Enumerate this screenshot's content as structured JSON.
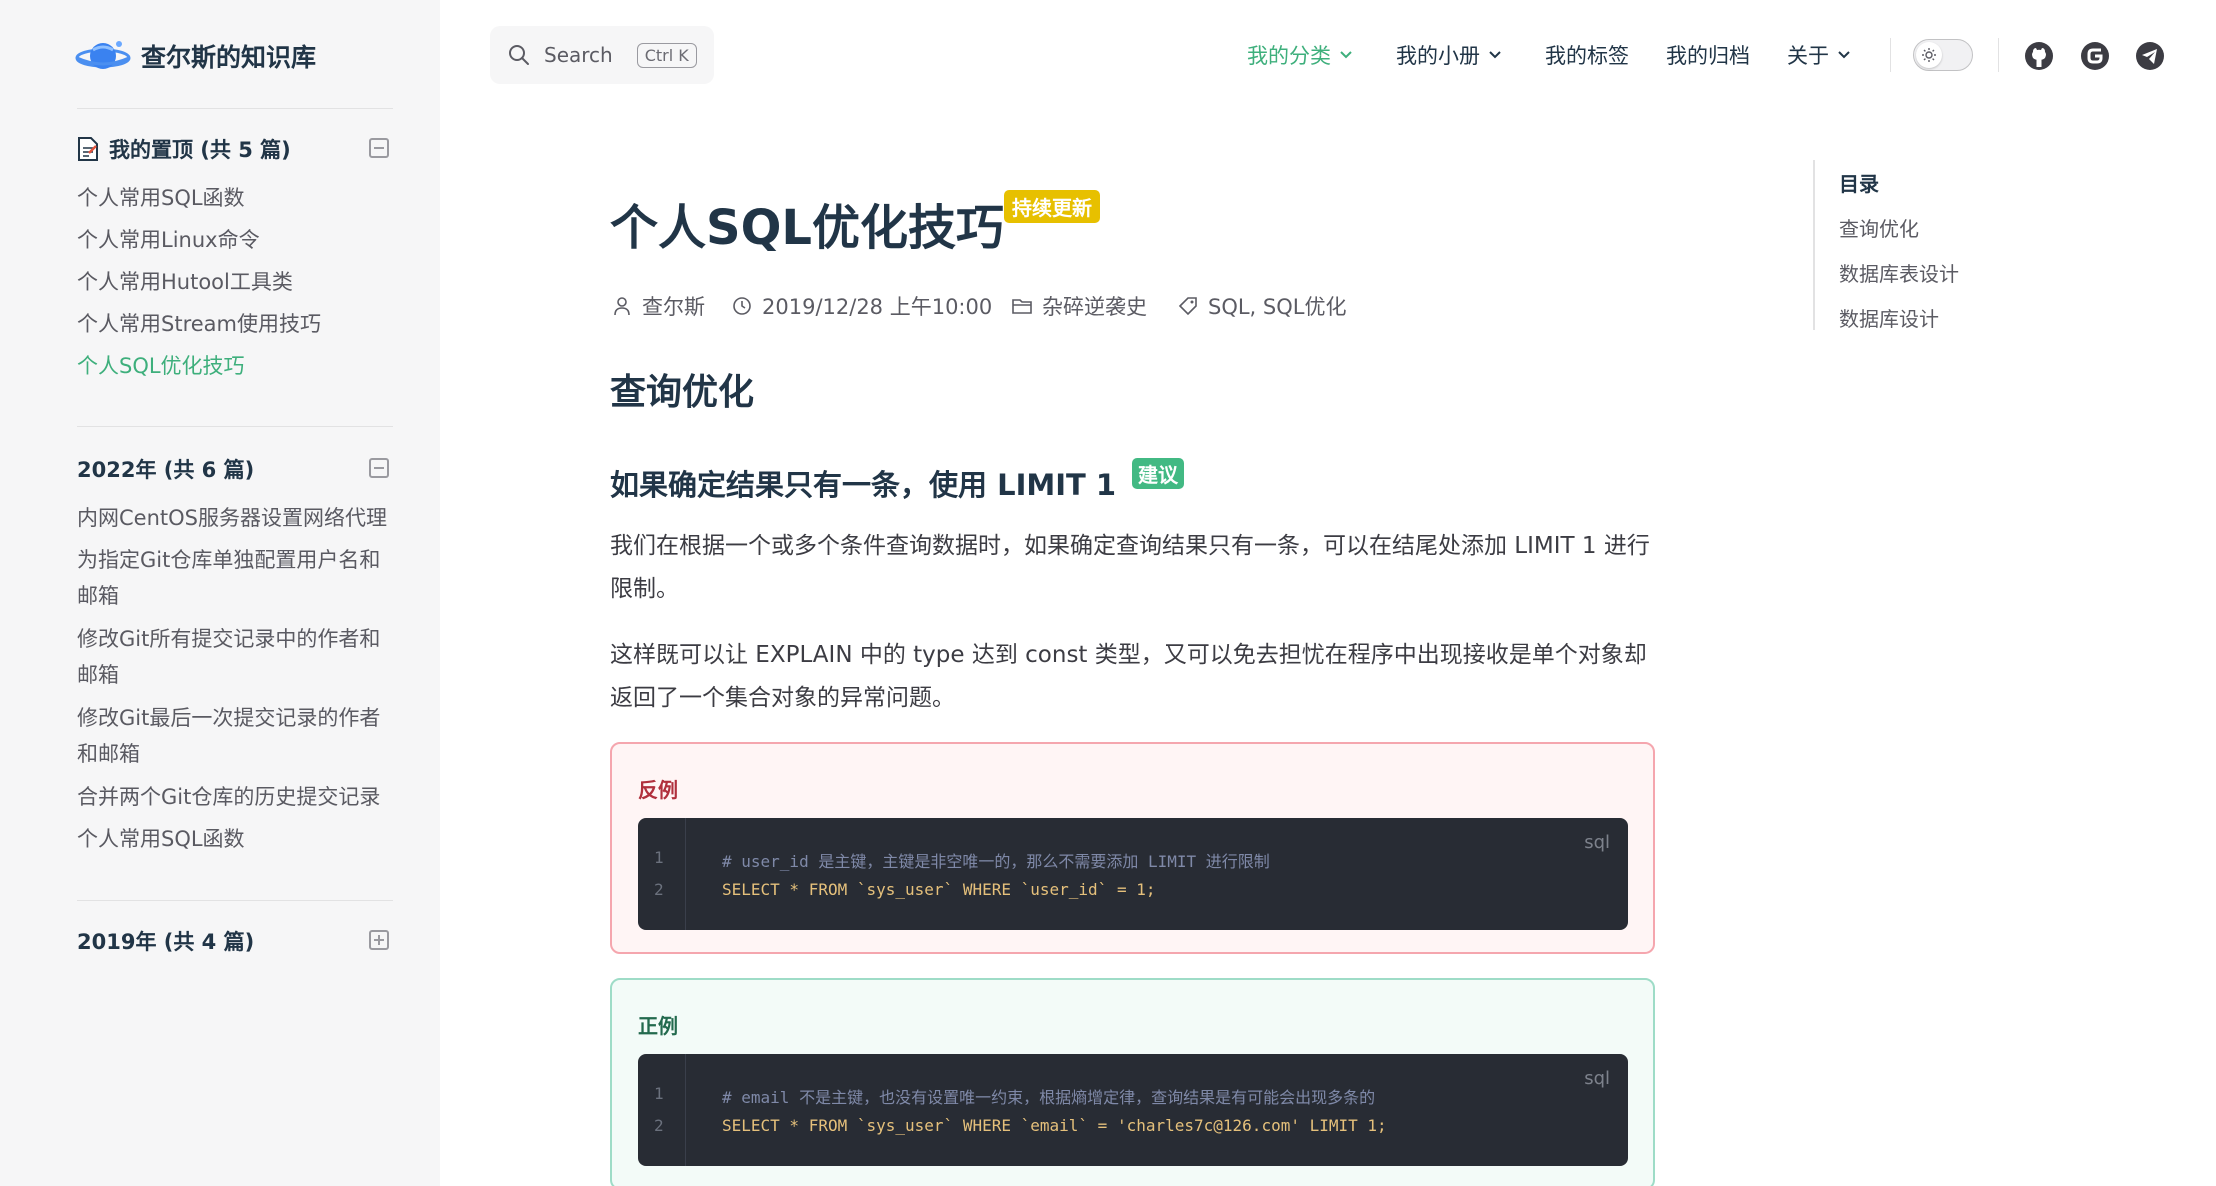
{
  "brand": {
    "title": "查尔斯的知识库"
  },
  "sidebar": {
    "groups": [
      {
        "title": "我的置顶 (共 5 篇)",
        "items": [
          "个人常用SQL函数",
          "个人常用Linux命令",
          "个人常用Hutool工具类",
          "个人常用Stream使用技巧",
          "个人SQL优化技巧"
        ],
        "active_index": 4
      },
      {
        "title": "2022年 (共 6 篇)",
        "items": [
          "内网CentOS服务器设置网络代理",
          "为指定Git仓库单独配置用户名和邮箱",
          "修改Git所有提交记录中的作者和邮箱",
          "修改Git最后一次提交记录的作者和邮箱",
          "合并两个Git仓库的历史提交记录",
          "个人常用SQL函数"
        ]
      },
      {
        "title": "2019年 (共 4 篇)",
        "items": []
      }
    ]
  },
  "search": {
    "label": "Search",
    "shortcut": "Ctrl K"
  },
  "nav": {
    "items": [
      "我的分类",
      "我的小册",
      "我的标签",
      "我的归档",
      "关于"
    ],
    "active": "我的分类"
  },
  "social_icons": [
    "github-icon",
    "gitee-icon",
    "telegram-icon"
  ],
  "article": {
    "title": "个人SQL优化技巧",
    "title_badge": "持续更新",
    "meta": {
      "author": "查尔斯",
      "date": "2019/12/28 上午10:00",
      "category": "杂碎逆袭史",
      "tags": "SQL, SQL优化"
    },
    "h2": "查询优化",
    "h3": "如果确定结果只有一条，使用 LIMIT 1",
    "h3_badge": "建议",
    "paragraphs": [
      "我们在根据一个或多个条件查询数据时，如果确定查询结果只有一条，可以在结尾处添加 LIMIT 1 进行限制。",
      "这样既可以让 EXPLAIN 中的 type 达到 const 类型，又可以免去担忧在程序中出现接收是单个对象却返回了一个集合对象的异常问题。"
    ],
    "bad_example": {
      "title": "反例",
      "lang": "sql",
      "line_numbers": [
        "1",
        "2"
      ],
      "comment": "# user_id 是主键，主键是非空唯一的，那么不需要添加 LIMIT 进行限制",
      "code": "SELECT * FROM `sys_user` WHERE `user_id` = 1;"
    },
    "good_example": {
      "title": "正例",
      "lang": "sql",
      "line_numbers": [
        "1",
        "2"
      ],
      "comment": "# email 不是主键，也没有设置唯一约束，根据熵增定律，查询结果是有可能会出现多条的",
      "code": "SELECT * FROM `sys_user` WHERE `email` = 'charles7c@126.com' LIMIT 1;"
    }
  },
  "toc": {
    "title": "目录",
    "items": [
      "查询优化",
      "数据库表设计",
      "数据库设计"
    ]
  },
  "colors": {
    "accent": "#3eaf7c",
    "warn_badge": "#e7c000",
    "tip_badge": "#42b983"
  }
}
